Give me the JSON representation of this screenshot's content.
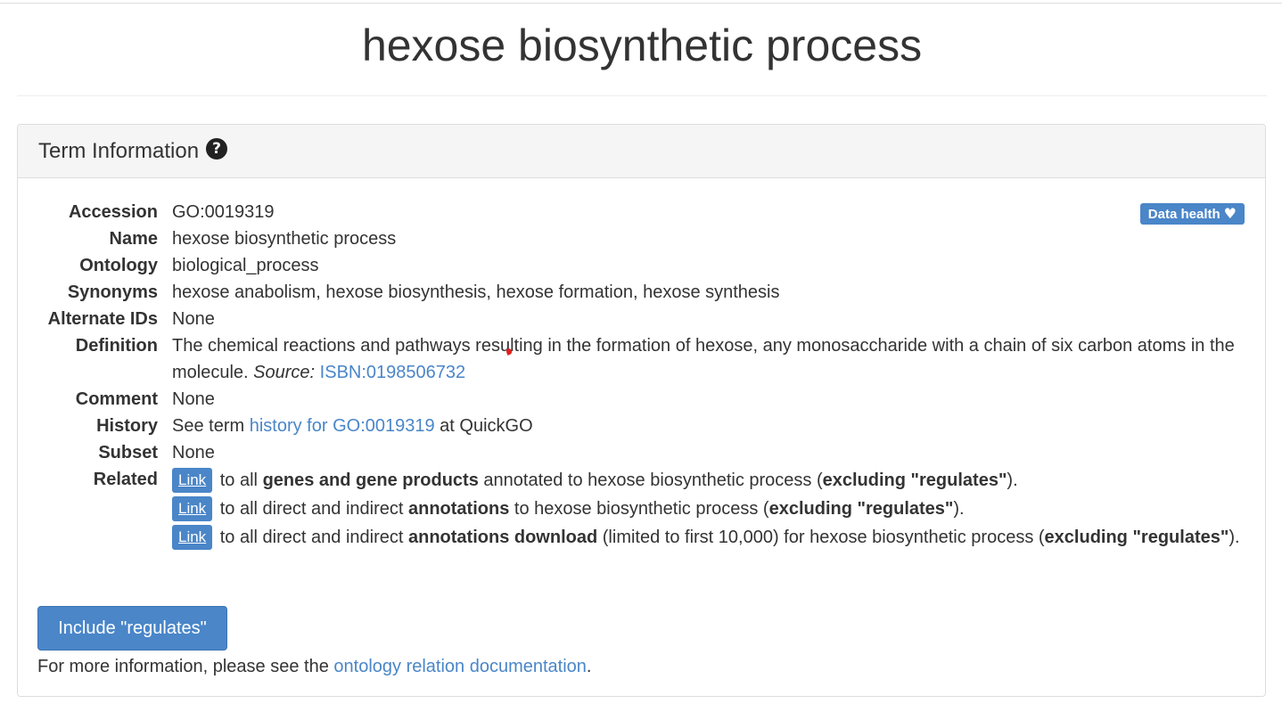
{
  "page": {
    "title": "hexose biosynthetic process"
  },
  "panel": {
    "heading": "Term Information",
    "help_icon": "question-circle-icon",
    "data_health_label": "Data health",
    "data_health_icon": "heart-icon"
  },
  "term": {
    "labels": {
      "accession": "Accession",
      "name": "Name",
      "ontology": "Ontology",
      "synonyms": "Synonyms",
      "alternate_ids": "Alternate IDs",
      "definition": "Definition",
      "comment": "Comment",
      "history": "History",
      "subset": "Subset",
      "related": "Related"
    },
    "accession": "GO:0019319",
    "name": "hexose biosynthetic process",
    "ontology": "biological_process",
    "synonyms": "hexose anabolism, hexose biosynthesis, hexose formation, hexose synthesis",
    "alternate_ids": "None",
    "definition": {
      "text": "The chemical reactions and pathways resulting in the formation of hexose, any monosaccharide with a chain of six carbon atoms in the molecule.",
      "source_label": "Source:",
      "source_link": "ISBN:0198506732"
    },
    "comment": "None",
    "history": {
      "prefix": "See term",
      "link": "history for GO:0019319",
      "suffix": "at QuickGO"
    },
    "subset": "None",
    "related": {
      "link_label": "Link",
      "items": [
        {
          "pre": "to all",
          "bold1": "genes and gene products",
          "mid": "annotated to hexose biosynthetic process (",
          "bold2": "excluding \"regulates\"",
          "post": ")."
        },
        {
          "pre": "to all direct and indirect",
          "bold1": "annotations",
          "mid": "to hexose biosynthetic process (",
          "bold2": "excluding \"regulates\"",
          "post": ")."
        },
        {
          "pre": "to all direct and indirect",
          "bold1": "annotations download",
          "mid": "(limited to first 10,000) for hexose biosynthetic process (",
          "bold2": "excluding \"regulates\"",
          "post": ")."
        }
      ]
    }
  },
  "footer": {
    "include_button": "Include \"regulates\"",
    "more_info_prefix": "For more information, please see the",
    "more_info_link": "ontology relation documentation",
    "more_info_suffix": "."
  },
  "colors": {
    "link": "#4a86c8",
    "button": "#4a86c8",
    "panel_heading_bg": "#f5f5f5"
  }
}
